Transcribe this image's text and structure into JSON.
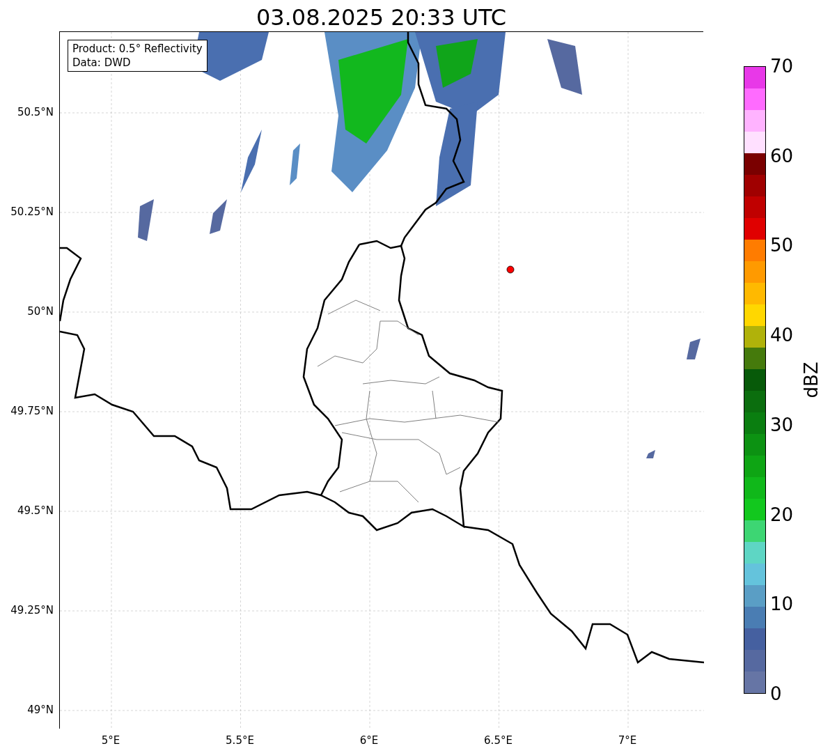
{
  "title": "03.08.2025 20:33 UTC",
  "map": {
    "annotation_lines": [
      "Product: 0.5° Reflectivity",
      "Data: DWD"
    ],
    "lat_ticks": [
      "50.5°N",
      "50.25°N",
      "50°N",
      "49.75°N",
      "49.5°N",
      "49.25°N",
      "49°N"
    ],
    "lon_ticks": [
      "5°E",
      "5.5°E",
      "6°E",
      "6.5°E",
      "7°E"
    ]
  },
  "colorbar": {
    "label": "dBZ",
    "ticks": [
      "70",
      "60",
      "50",
      "40",
      "30",
      "20",
      "10",
      "0"
    ],
    "bins": [
      {
        "color": "#6675a5"
      },
      {
        "color": "#5669a0"
      },
      {
        "color": "#4560a0"
      },
      {
        "color": "#4a7db3"
      },
      {
        "color": "#5a9ec5"
      },
      {
        "color": "#64c3dc"
      },
      {
        "color": "#5ed6c4"
      },
      {
        "color": "#3dd673"
      },
      {
        "color": "#12c81e"
      },
      {
        "color": "#10b81a"
      },
      {
        "color": "#0ea514"
      },
      {
        "color": "#0c9212"
      },
      {
        "color": "#0a7e10"
      },
      {
        "color": "#0b6e0e"
      },
      {
        "color": "#075a09"
      },
      {
        "color": "#457a0c"
      },
      {
        "color": "#b0b20a"
      },
      {
        "color": "#ffd700"
      },
      {
        "color": "#ffb900"
      },
      {
        "color": "#ff9a00"
      },
      {
        "color": "#ff7c00"
      },
      {
        "color": "#e00000"
      },
      {
        "color": "#c00000"
      },
      {
        "color": "#a00000"
      },
      {
        "color": "#7a0000"
      },
      {
        "color": "#ffe0ff"
      },
      {
        "color": "#ffb3ff"
      },
      {
        "color": "#ff6bff"
      },
      {
        "color": "#e838e8"
      }
    ]
  }
}
